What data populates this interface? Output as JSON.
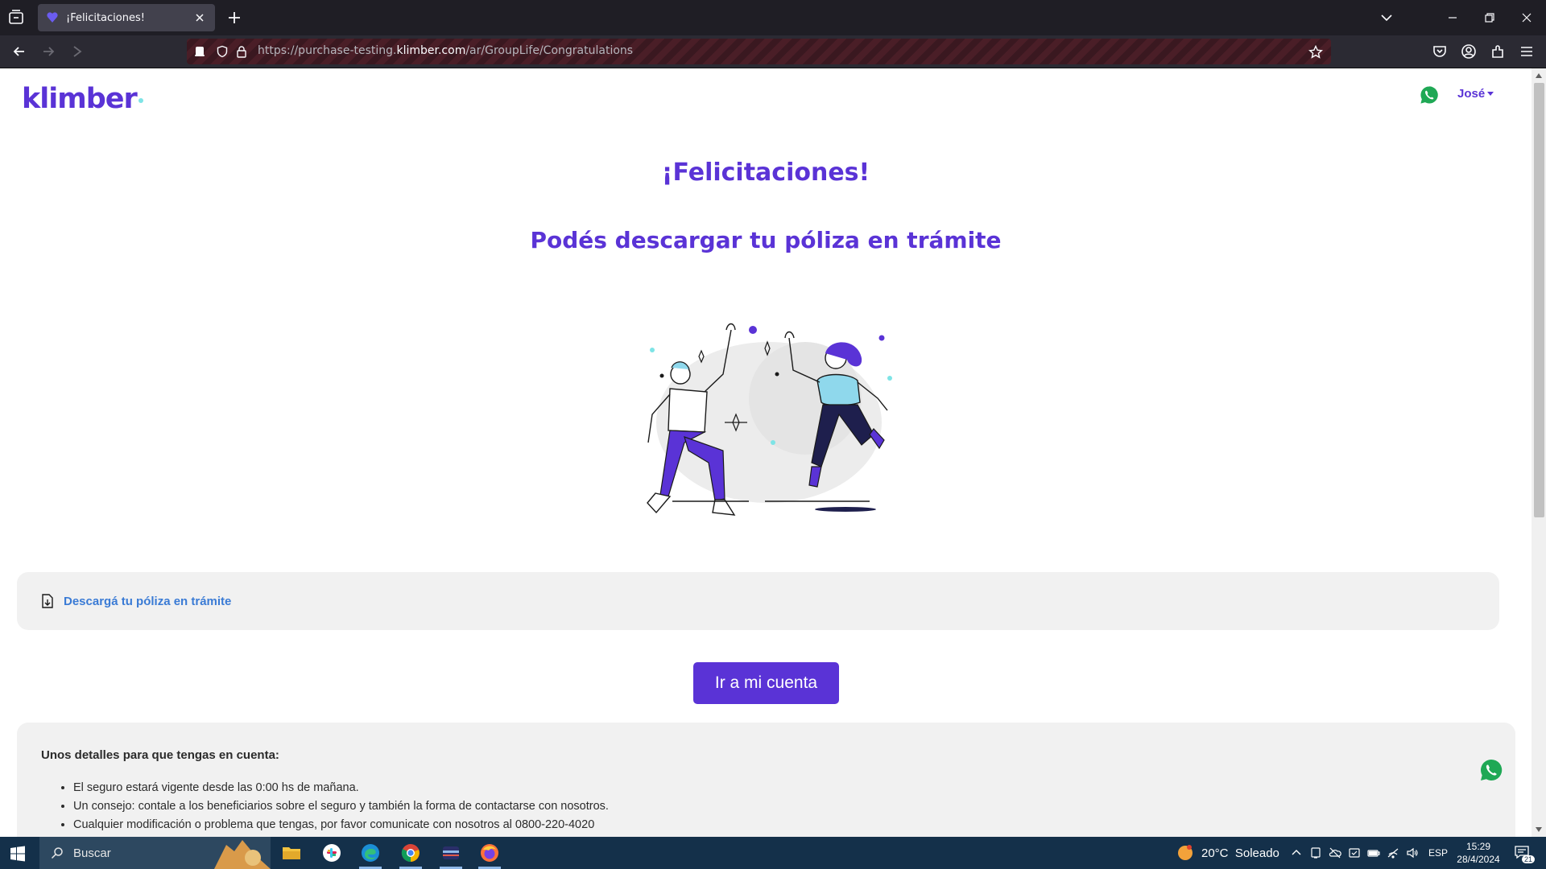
{
  "browser": {
    "tab": {
      "title": "¡Felicitaciones!"
    },
    "url": {
      "prefix": "https://purchase-testing.",
      "domain": "klimber.com",
      "path": "/ar/GroupLife/Congratulations"
    }
  },
  "page": {
    "logo": "klimber",
    "user_menu": "José",
    "heading": "¡Felicitaciones!",
    "subheading": "Podés descargar tu póliza en trámite",
    "download_link": "Descargá tu póliza en trámite",
    "cta_button": "Ir a mi cuenta",
    "details": {
      "title": "Unos detalles para que tengas en cuenta:",
      "items": [
        "El seguro estará vigente desde las 0:00 hs de mañana.",
        "Un consejo: contale a los beneficiarios sobre el seguro y también la forma de contactarse con nosotros.",
        "Cualquier modificación o problema que tengas, por favor comunicate con nosotros al 0800-220-4020"
      ]
    }
  },
  "taskbar": {
    "search_placeholder": "Buscar",
    "weather": "20°C  Soleado",
    "language": "ESP",
    "time": "15:29",
    "date": "28/4/2024",
    "notifications": "21"
  },
  "colors": {
    "brand": "#5a33d6",
    "link": "#3a7bd5",
    "panel": "#f1f1f1",
    "whatsapp": "#1fa855"
  }
}
